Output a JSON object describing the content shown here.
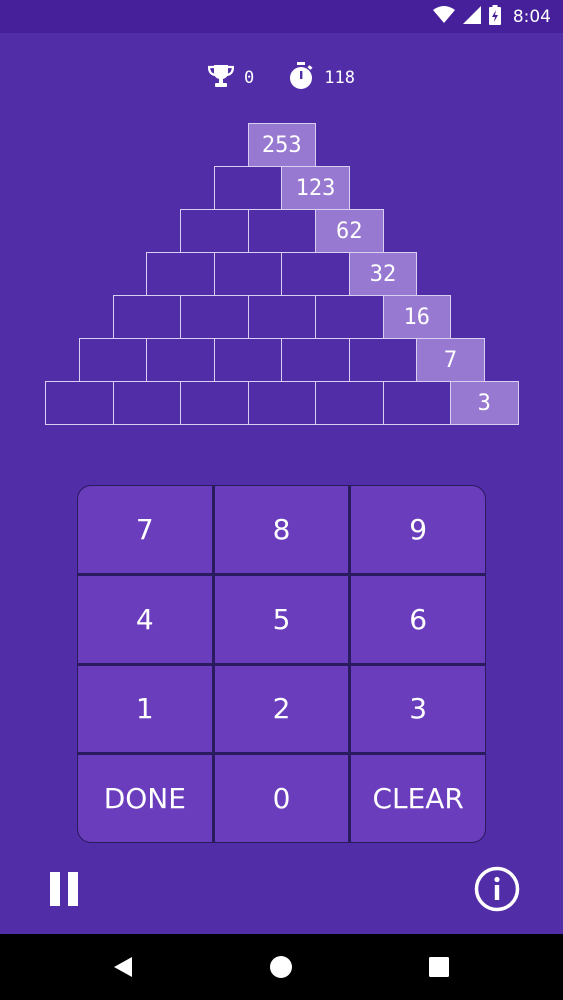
{
  "status_bar": {
    "time": "8:04"
  },
  "stats": {
    "trophy_count": "0",
    "timer_value": "118"
  },
  "pyramid": {
    "rows": [
      [
        "253"
      ],
      [
        "",
        "123"
      ],
      [
        "",
        "",
        "62"
      ],
      [
        "",
        "",
        "",
        "32"
      ],
      [
        "",
        "",
        "",
        "",
        "16"
      ],
      [
        "",
        "",
        "",
        "",
        "",
        "7"
      ],
      [
        "",
        "",
        "",
        "",
        "",
        "",
        "3"
      ]
    ]
  },
  "keypad": {
    "keys": [
      "7",
      "8",
      "9",
      "4",
      "5",
      "6",
      "1",
      "2",
      "3",
      "DONE",
      "0",
      "CLEAR"
    ]
  },
  "colors": {
    "background": "#522da8",
    "status_bar": "#45209a",
    "brick_filled": "#9879d1",
    "key": "#6a3dbd"
  }
}
